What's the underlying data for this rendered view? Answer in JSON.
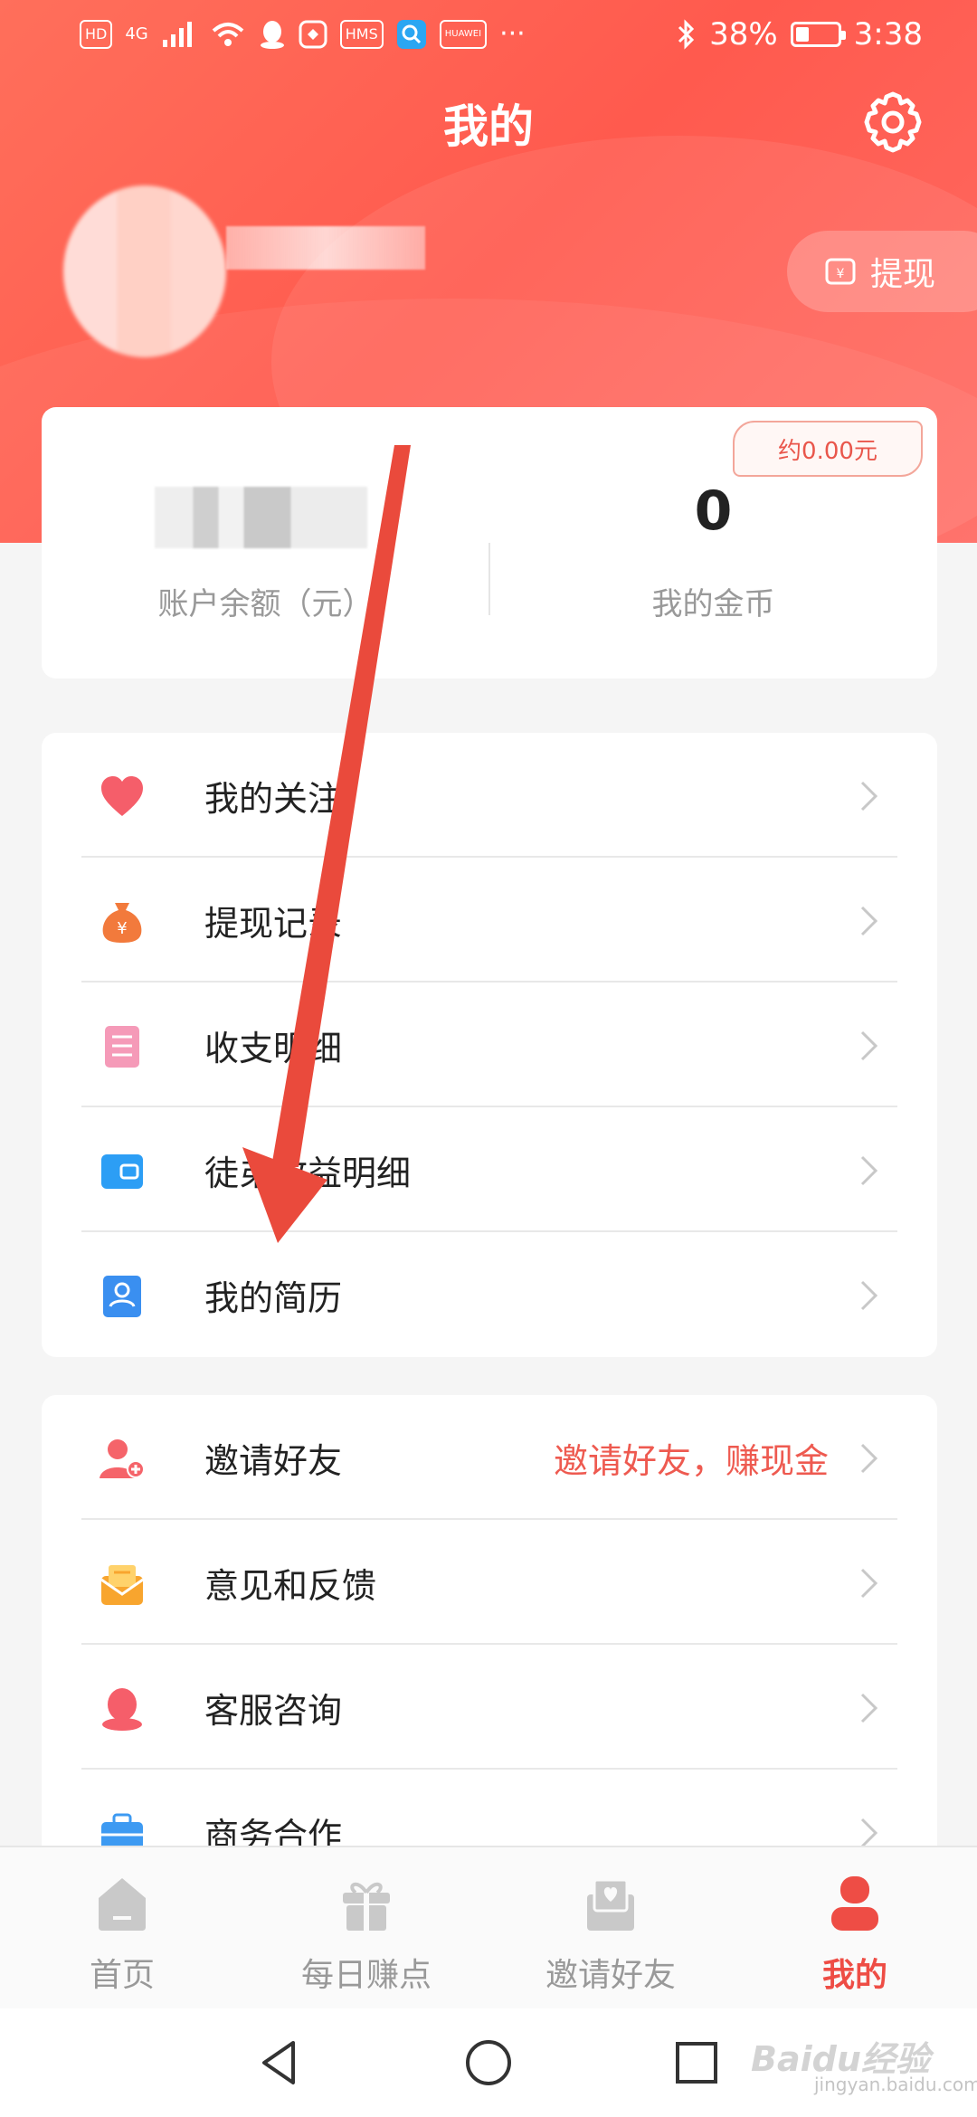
{
  "status_bar": {
    "left_badges": [
      "HD",
      "4G",
      "HMS",
      "HUAWEI"
    ],
    "battery_percent": "38%",
    "time": "3:38"
  },
  "header": {
    "title": "我的",
    "withdraw_label": "提现"
  },
  "balance": {
    "account_label": "账户余额（元）",
    "coins_value": "0",
    "coins_label": "我的金币",
    "coins_badge": "约0.00元"
  },
  "menu_primary": [
    {
      "label": "我的关注",
      "icon": "heart-icon"
    },
    {
      "label": "提现记录",
      "icon": "money-bag-icon"
    },
    {
      "label": "收支明细",
      "icon": "list-icon"
    },
    {
      "label": "徒弟收益明细",
      "icon": "wallet-icon"
    },
    {
      "label": "我的简历",
      "icon": "resume-icon"
    }
  ],
  "menu_secondary": [
    {
      "label": "邀请好友",
      "extra": "邀请好友，赚现金",
      "icon": "add-user-icon"
    },
    {
      "label": "意见和反馈",
      "icon": "mail-icon"
    },
    {
      "label": "客服咨询",
      "icon": "support-icon"
    },
    {
      "label": "商务合作",
      "icon": "briefcase-icon"
    }
  ],
  "bottom_nav": [
    {
      "label": "首页",
      "icon": "home-icon"
    },
    {
      "label": "每日赚点",
      "icon": "gift-icon"
    },
    {
      "label": "邀请好友",
      "icon": "invite-icon"
    },
    {
      "label": "我的",
      "icon": "profile-icon",
      "active": true
    }
  ],
  "watermark": {
    "text": "Baidu经验",
    "sub": "jingyan.baidu.com"
  },
  "colors": {
    "accent": "#ff5a4e",
    "active": "#ee4d45",
    "link": "#ee5a50"
  }
}
